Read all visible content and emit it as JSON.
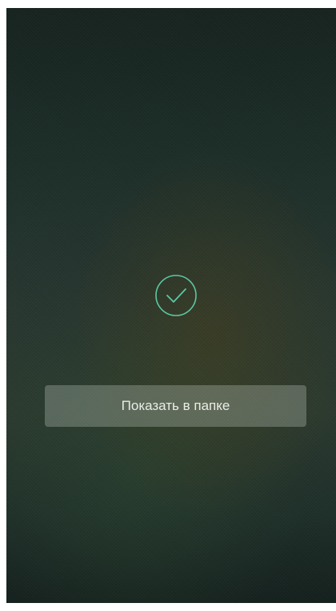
{
  "status_icon": "check-circle-icon",
  "accent_color": "#5cc7a4",
  "actions": {
    "show_in_folder_label": "Показать в папке"
  }
}
